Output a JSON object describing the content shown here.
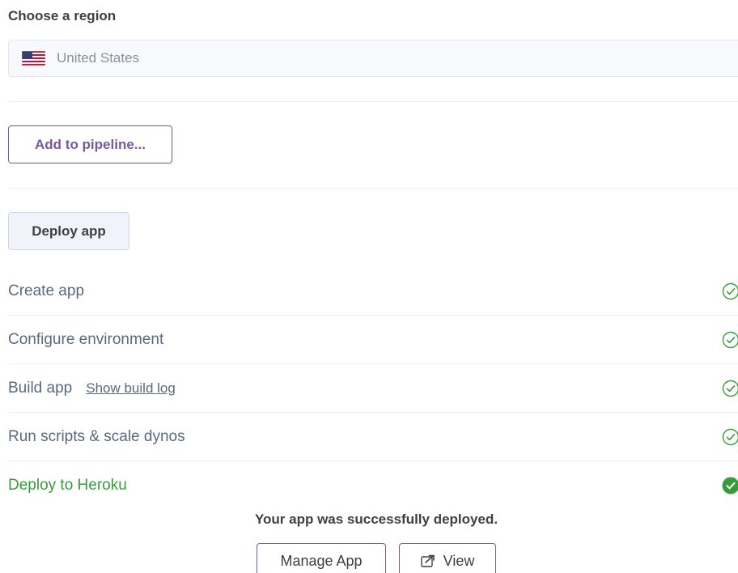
{
  "region": {
    "label": "Choose a region",
    "selected": "United States",
    "flag_icon": "us-flag-icon"
  },
  "pipeline": {
    "button_label": "Add to pipeline..."
  },
  "deploy": {
    "button_label": "Deploy app",
    "steps": [
      {
        "label": "Create app",
        "status": "done"
      },
      {
        "label": "Configure environment",
        "status": "done"
      },
      {
        "label": "Build app",
        "link": "Show build log",
        "status": "done"
      },
      {
        "label": "Run scripts & scale dynos",
        "status": "done"
      },
      {
        "label": "Deploy to Heroku",
        "status": "complete"
      }
    ],
    "success_message": "Your app was successfully deployed.",
    "manage_label": "Manage App",
    "view_label": "View",
    "view_icon": "external-link-icon"
  },
  "colors": {
    "brand": "#79589f",
    "success": "#3a9b3e",
    "muted_text": "#596981"
  }
}
